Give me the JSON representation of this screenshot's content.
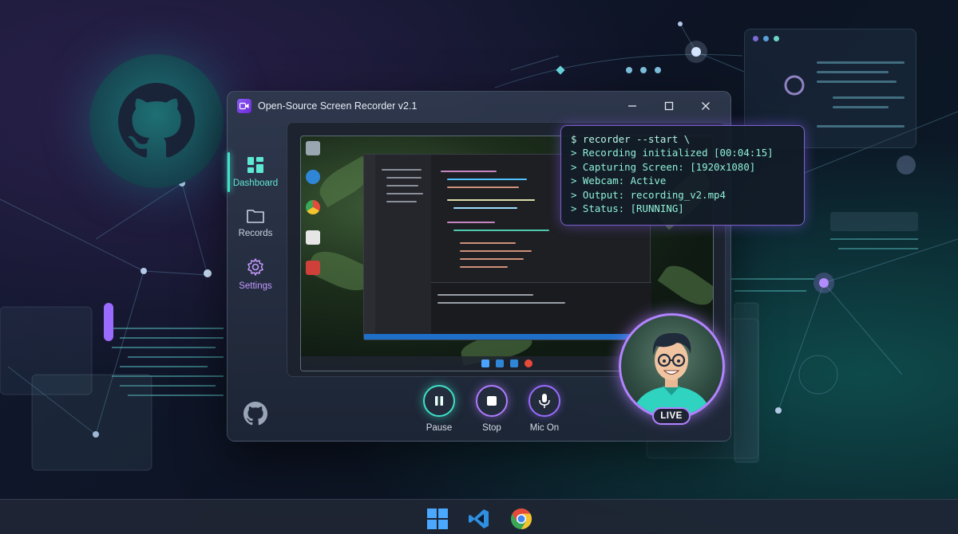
{
  "window": {
    "title": "Open-Source Screen Recorder v2.1",
    "controls": {
      "minimize_icon": "minimize-icon",
      "maximize_icon": "maximize-icon",
      "close_icon": "close-icon"
    }
  },
  "sidebar": {
    "items": [
      {
        "label": "Dashboard",
        "icon": "dashboard-icon",
        "active": true
      },
      {
        "label": "Records",
        "icon": "folder-icon",
        "active": false
      },
      {
        "label": "Settings",
        "icon": "gear-icon",
        "active": false
      }
    ],
    "footer_icon": "github-icon"
  },
  "controls": {
    "pause_label": "Pause",
    "stop_label": "Stop",
    "mic_label": "Mic On"
  },
  "terminal": {
    "lines": [
      "$ recorder --start \\",
      "> Recording initialized [00:04:15]",
      "> Capturing Screen: [1920x1080]",
      "> Webcam: Active",
      "> Output: recording_v2.mp4",
      "> Status: [RUNNING]"
    ]
  },
  "webcam": {
    "badge": "LIVE"
  },
  "taskbar": {
    "icons": [
      "windows-start-icon",
      "vscode-icon",
      "chrome-icon"
    ]
  },
  "colors": {
    "accent_teal": "#3fe0c8",
    "accent_purple": "#b283ff",
    "terminal_text": "#8ff0d8"
  }
}
